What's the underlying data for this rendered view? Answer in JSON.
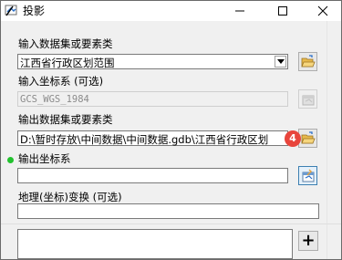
{
  "window": {
    "title": "投影",
    "minimize_glyph": "—",
    "maximize_glyph": "□",
    "close_glyph": "✕"
  },
  "input_dataset": {
    "label": "输入数据集或要素类",
    "value": "江西省行政区划范围"
  },
  "input_crs": {
    "label": "输入坐标系 (可选)",
    "value": "GCS_WGS_1984"
  },
  "output_dataset": {
    "label": "输出数据集或要素类",
    "value": "D:\\暂时存放\\中间数据\\中间数据.gdb\\江西省行政区划",
    "badge": "4"
  },
  "output_crs": {
    "label": "输出坐标系",
    "value": ""
  },
  "geo_transform": {
    "label": "地理(坐标)变换 (可选)",
    "value": "",
    "add_label": "+"
  },
  "colors": {
    "badge": "#e8453c",
    "required_dot": "#22c22e",
    "folder": "#e7b94c",
    "active_border": "#3c7fb1"
  },
  "icons": [
    "app-icon",
    "folder-open-icon",
    "coordinate-properties-icon",
    "plus-icon"
  ]
}
